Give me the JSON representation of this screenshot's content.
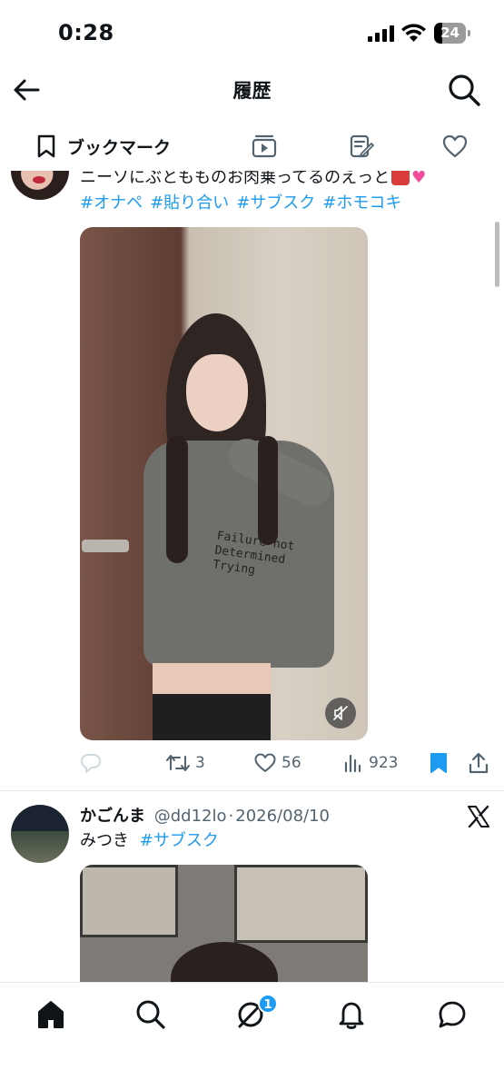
{
  "status_bar": {
    "time": "0:28",
    "battery_level": "24"
  },
  "header": {
    "title": "履歴"
  },
  "tabs": [
    {
      "label": "ブックマーク",
      "icon": "bookmark-icon",
      "active": true
    },
    {
      "label": "",
      "icon": "media-icon"
    },
    {
      "label": "",
      "icon": "drafts-icon"
    },
    {
      "label": "",
      "icon": "heart-icon"
    }
  ],
  "tweets": [
    {
      "text_line1": "ニーソにぶともものお肉乗ってるのえっと",
      "hashtags": [
        "#オナペ",
        "#貼り合い",
        "#サブスク",
        "#ホモコキ"
      ],
      "media_shirt_text": "Failure not Determined Trying",
      "actions": {
        "retweets": "3",
        "likes": "56",
        "views": "923",
        "bookmarked": true
      }
    },
    {
      "name": "かごんま",
      "handle": "@dd12lo",
      "date": "2026/08/10",
      "text": "みつき",
      "hashtags": [
        "#サブスク"
      ]
    }
  ],
  "bottom_nav": {
    "items": [
      "home-icon",
      "search-icon",
      "grok-icon",
      "notifications-icon",
      "messages-icon"
    ],
    "badge_count": "1"
  },
  "colors": {
    "accent": "#1d9bf0",
    "text": "#0f1419",
    "muted": "#536471"
  }
}
